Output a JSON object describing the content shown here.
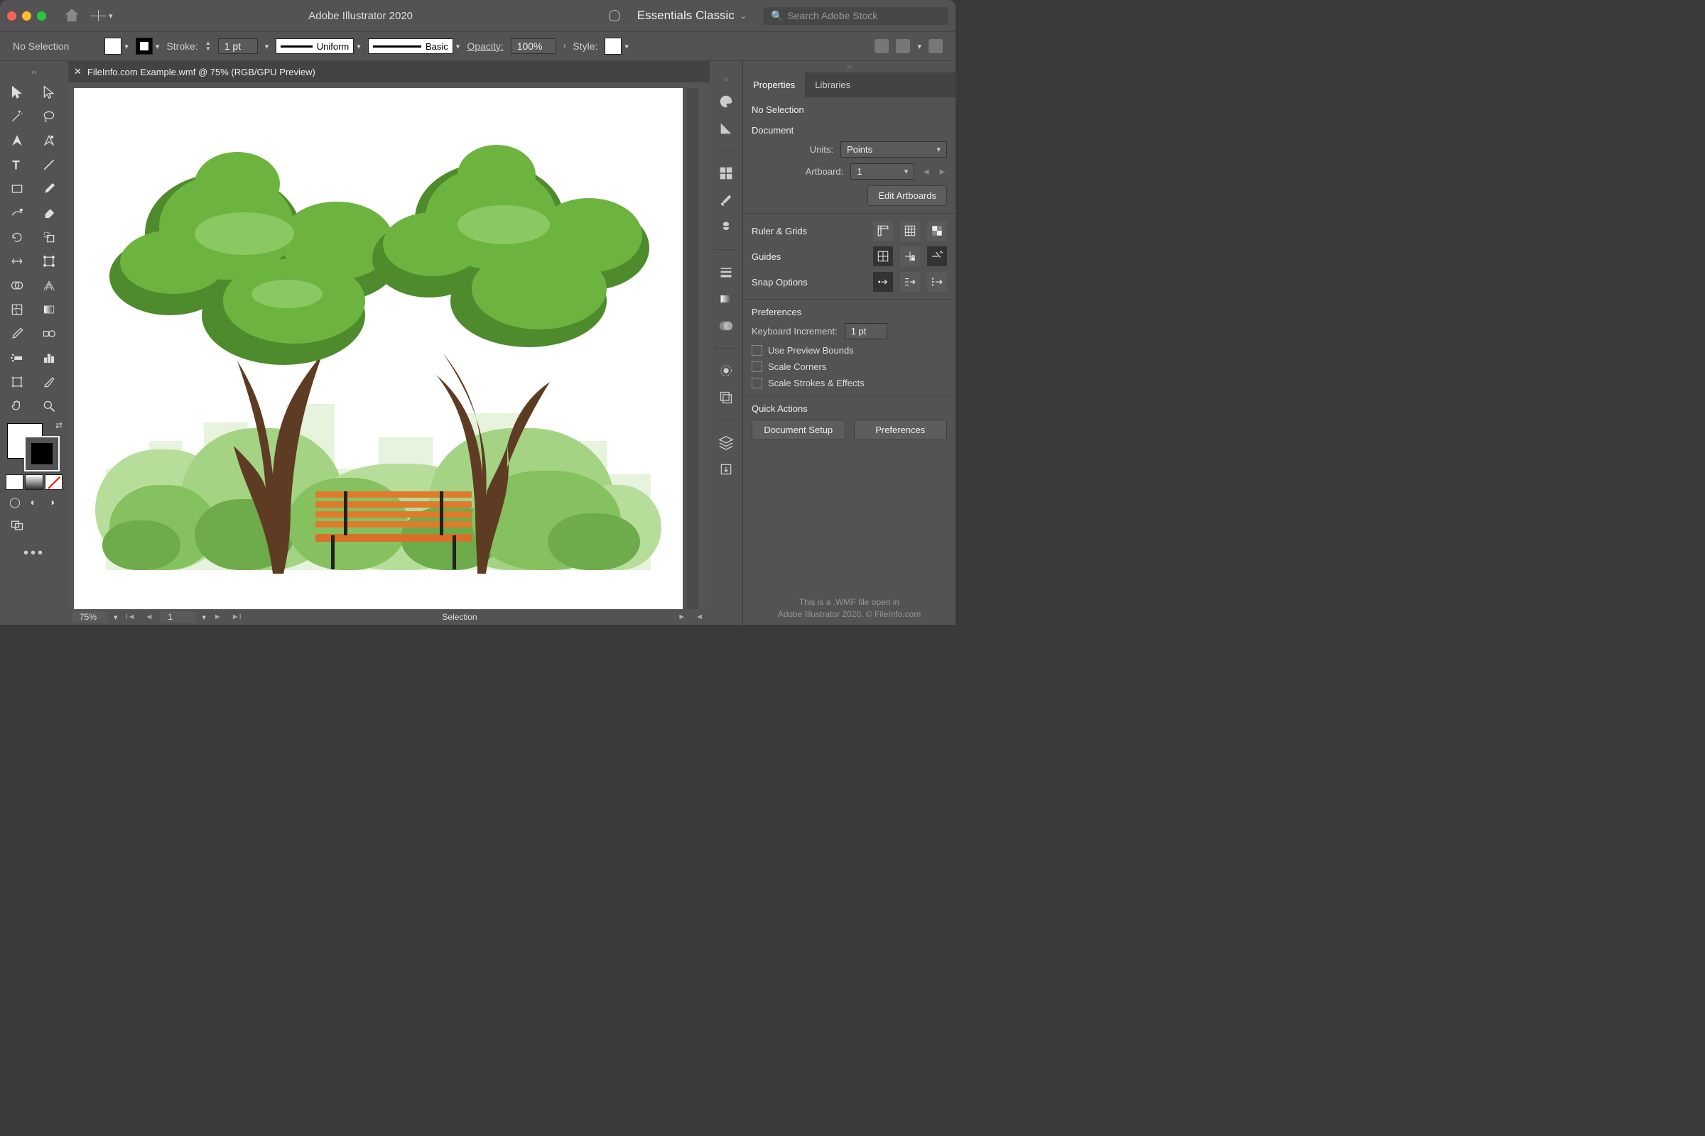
{
  "app": {
    "title": "Adobe Illustrator 2020",
    "workspace": "Essentials Classic",
    "search_placeholder": "Search Adobe Stock"
  },
  "control": {
    "selection_state": "No Selection",
    "stroke_label": "Stroke:",
    "stroke_value": "1 pt",
    "stroke_profile": "Uniform",
    "brush": "Basic",
    "opacity_label": "Opacity:",
    "opacity_value": "100%",
    "style_label": "Style:"
  },
  "doc": {
    "tab_title": "FileInfo.com Example.wmf @ 75% (RGB/GPU Preview)"
  },
  "status": {
    "zoom": "75%",
    "artboard": "1",
    "tool": "Selection"
  },
  "panels": {
    "tabs": {
      "properties": "Properties",
      "libraries": "Libraries"
    },
    "no_selection": "No Selection",
    "document": {
      "heading": "Document",
      "units_label": "Units:",
      "units_value": "Points",
      "artboard_label": "Artboard:",
      "artboard_value": "1",
      "edit_artboards": "Edit Artboards"
    },
    "ruler_grids": "Ruler & Grids",
    "guides": "Guides",
    "snap": "Snap Options",
    "prefs": {
      "heading": "Preferences",
      "keyboard_inc_label": "Keyboard Increment:",
      "keyboard_inc_value": "1 pt",
      "preview_bounds": "Use Preview Bounds",
      "scale_corners": "Scale Corners",
      "scale_strokes": "Scale Strokes & Effects"
    },
    "quick": {
      "heading": "Quick Actions",
      "doc_setup": "Document Setup",
      "preferences": "Preferences"
    },
    "footer1": "This is a .WMF file open in",
    "footer2": "Adobe Illustrator 2020. © FileInfo.com"
  }
}
